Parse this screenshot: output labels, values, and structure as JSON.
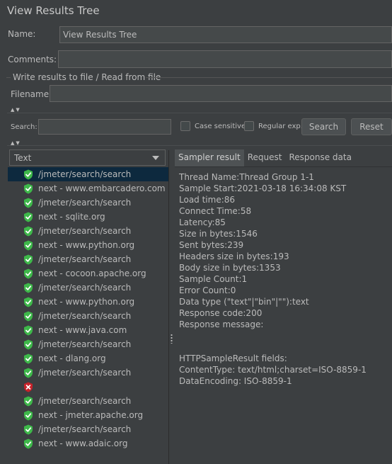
{
  "window": {
    "title": "View Results Tree"
  },
  "form": {
    "name_label": "Name:",
    "name_value": "View Results Tree",
    "comments_label": "Comments:",
    "comments_value": "",
    "file_group_label": "Write results to file / Read from file",
    "filename_label": "Filename",
    "filename_value": ""
  },
  "search": {
    "label": "Search:",
    "value": "",
    "case_sensitive_label": "Case sensitive",
    "regex_label": "Regular exp.",
    "search_button": "Search",
    "reset_button": "Reset"
  },
  "renderer": {
    "selected": "Text"
  },
  "tree": [
    {
      "label": "/jmeter/search/search",
      "status": "ok",
      "selected": true
    },
    {
      "label": "next - www.embarcadero.com",
      "status": "ok"
    },
    {
      "label": "/jmeter/search/search",
      "status": "ok"
    },
    {
      "label": "next - sqlite.org",
      "status": "ok"
    },
    {
      "label": "/jmeter/search/search",
      "status": "ok"
    },
    {
      "label": "next - www.python.org",
      "status": "ok"
    },
    {
      "label": "/jmeter/search/search",
      "status": "ok"
    },
    {
      "label": "next - cocoon.apache.org",
      "status": "ok"
    },
    {
      "label": "/jmeter/search/search",
      "status": "ok"
    },
    {
      "label": "next - www.python.org",
      "status": "ok"
    },
    {
      "label": "/jmeter/search/search",
      "status": "ok"
    },
    {
      "label": "next - www.java.com",
      "status": "ok"
    },
    {
      "label": "/jmeter/search/search",
      "status": "ok"
    },
    {
      "label": "next - dlang.org",
      "status": "ok"
    },
    {
      "label": "/jmeter/search/search",
      "status": "ok"
    },
    {
      "label": "",
      "status": "error"
    },
    {
      "label": "/jmeter/search/search",
      "status": "ok"
    },
    {
      "label": "next - jmeter.apache.org",
      "status": "ok"
    },
    {
      "label": "/jmeter/search/search",
      "status": "ok"
    },
    {
      "label": "next - www.adaic.org",
      "status": "ok"
    }
  ],
  "tabs": {
    "sampler_result": "Sampler result",
    "request": "Request",
    "response_data": "Response data"
  },
  "sampler_result": {
    "lines": [
      "Thread Name:Thread Group 1-1",
      "Sample Start:2021-03-18 16:34:08 KST",
      "Load time:86",
      "Connect Time:58",
      "Latency:85",
      "Size in bytes:1546",
      "Sent bytes:239",
      "Headers size in bytes:193",
      "Body size in bytes:1353",
      "Sample Count:1",
      "Error Count:0",
      "Data type (\"text\"|\"bin\"|\"\"):text",
      "Response code:200",
      "Response message:",
      "",
      "",
      "HTTPSampleResult fields:",
      "ContentType: text/html;charset=ISO-8859-1",
      "DataEncoding: ISO-8859-1"
    ]
  },
  "colors": {
    "background": "#3c3f41",
    "selected_row": "#0d293e",
    "ok_icon": "#3eb84a",
    "error_icon": "#c7222a"
  }
}
